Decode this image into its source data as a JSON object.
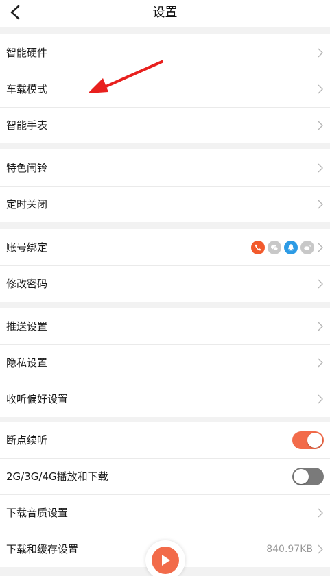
{
  "header": {
    "title": "设置"
  },
  "groups": [
    {
      "items": [
        {
          "label": "智能硬件"
        },
        {
          "label": "车载模式"
        },
        {
          "label": "智能手表"
        }
      ]
    },
    {
      "items": [
        {
          "label": "特色闹铃"
        },
        {
          "label": "定时关闭"
        }
      ]
    },
    {
      "items": [
        {
          "label": "账号绑定",
          "accounts": [
            "phone-icon",
            "wechat-icon",
            "qq-icon",
            "weibo-icon"
          ]
        },
        {
          "label": "修改密码"
        }
      ]
    },
    {
      "items": [
        {
          "label": "推送设置"
        },
        {
          "label": "隐私设置"
        },
        {
          "label": "收听偏好设置"
        }
      ]
    },
    {
      "items": [
        {
          "label": "断点续听",
          "toggle": true
        },
        {
          "label": "2G/3G/4G播放和下载",
          "toggle": false
        },
        {
          "label": "下载音质设置"
        },
        {
          "label": "下载和缓存设置",
          "value": "840.97KB"
        }
      ]
    }
  ],
  "colors": {
    "accent": "#f26b4a",
    "toggle_off": "#7a7a7a",
    "phone": "#f25a2c",
    "wechat": "#c8c8c8",
    "qq": "#2d9be5",
    "weibo": "#c8c8c8",
    "annotation_arrow": "#e8201e"
  }
}
